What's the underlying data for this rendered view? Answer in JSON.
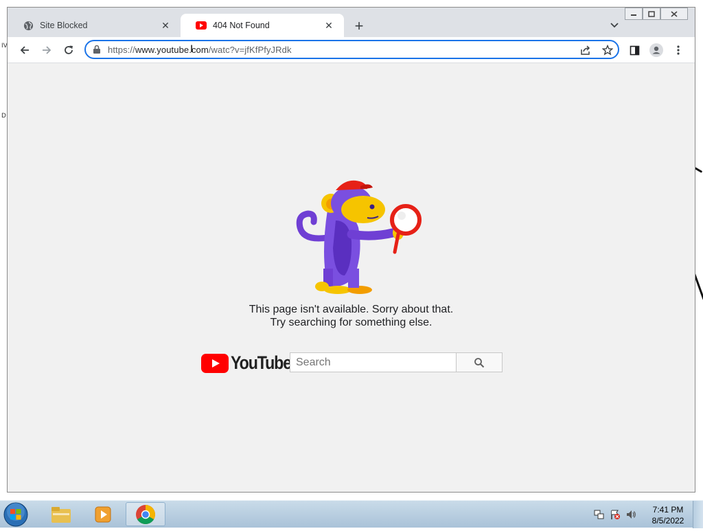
{
  "desktop": {
    "fragment_1": "IV",
    "fragment_2": "D"
  },
  "browser": {
    "tabs": [
      {
        "title": "Site Blocked",
        "favicon": "globe-icon",
        "active": false
      },
      {
        "title": "404 Not Found",
        "favicon": "youtube-icon",
        "active": true
      }
    ],
    "address": {
      "scheme": "https://",
      "host": "www.youtube.com",
      "path": "/watc?v=jfKfPfyJRdk"
    }
  },
  "page": {
    "message_line1": "This page isn't available. Sorry about that.",
    "message_line2": "Try searching for something else.",
    "logo_text": "YouTube",
    "search_placeholder": "Search",
    "search_value": ""
  },
  "taskbar": {
    "apps": [
      "start-orb",
      "file-explorer",
      "media-player",
      "chrome"
    ],
    "time": "7:41 PM",
    "date": "8/5/2022"
  },
  "colors": {
    "accent": "#1a73e8",
    "youtube_red": "#ff0000",
    "monkey_purple": "#6f3fd4"
  }
}
